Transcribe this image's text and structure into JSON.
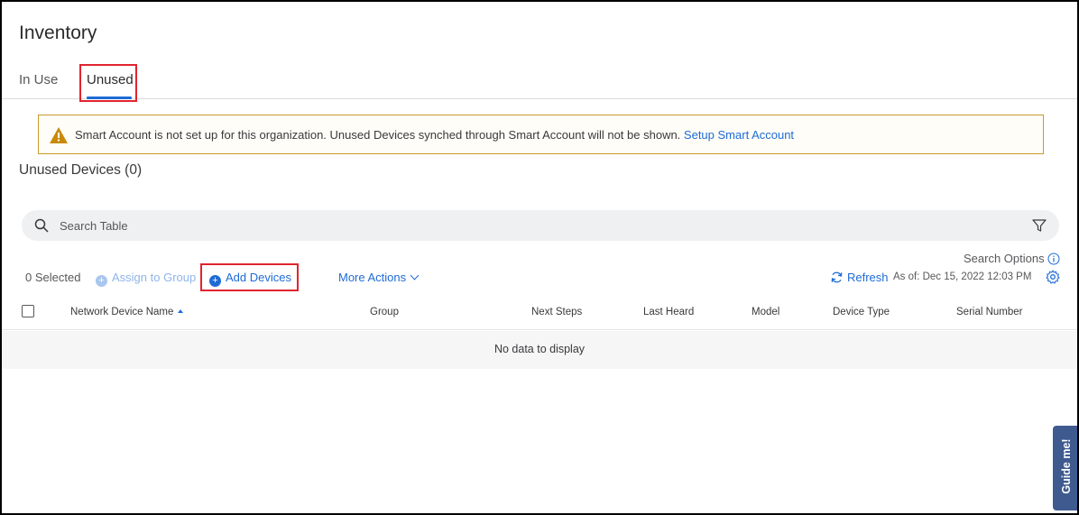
{
  "page": {
    "title": "Inventory"
  },
  "tabs": [
    {
      "label": "In Use"
    },
    {
      "label": "Unused"
    }
  ],
  "alert": {
    "message": "Smart Account is not set up for this organization. Unused Devices synched through Smart Account will not be shown.",
    "link_label": "Setup Smart Account"
  },
  "section": {
    "title": "Unused Devices (0)"
  },
  "search": {
    "placeholder": "Search Table",
    "options_label": "Search Options"
  },
  "toolbar": {
    "selected_label": "0 Selected",
    "assign_group_label": "Assign to Group",
    "add_devices_label": "Add Devices",
    "more_actions_label": "More Actions",
    "refresh_label": "Refresh",
    "as_of_label": "As of: Dec 15, 2022 12:03 PM"
  },
  "table": {
    "columns": [
      "Network Device Name",
      "Group",
      "Next Steps",
      "Last Heard",
      "Model",
      "Device Type",
      "Serial Number"
    ],
    "empty_message": "No data to display"
  },
  "guide": {
    "label": "Guide me!"
  },
  "colors": {
    "accent": "#1e6bd6",
    "highlight": "#e0242f",
    "warning": "#c99a2e",
    "guide_bg": "#3f5a8f"
  }
}
